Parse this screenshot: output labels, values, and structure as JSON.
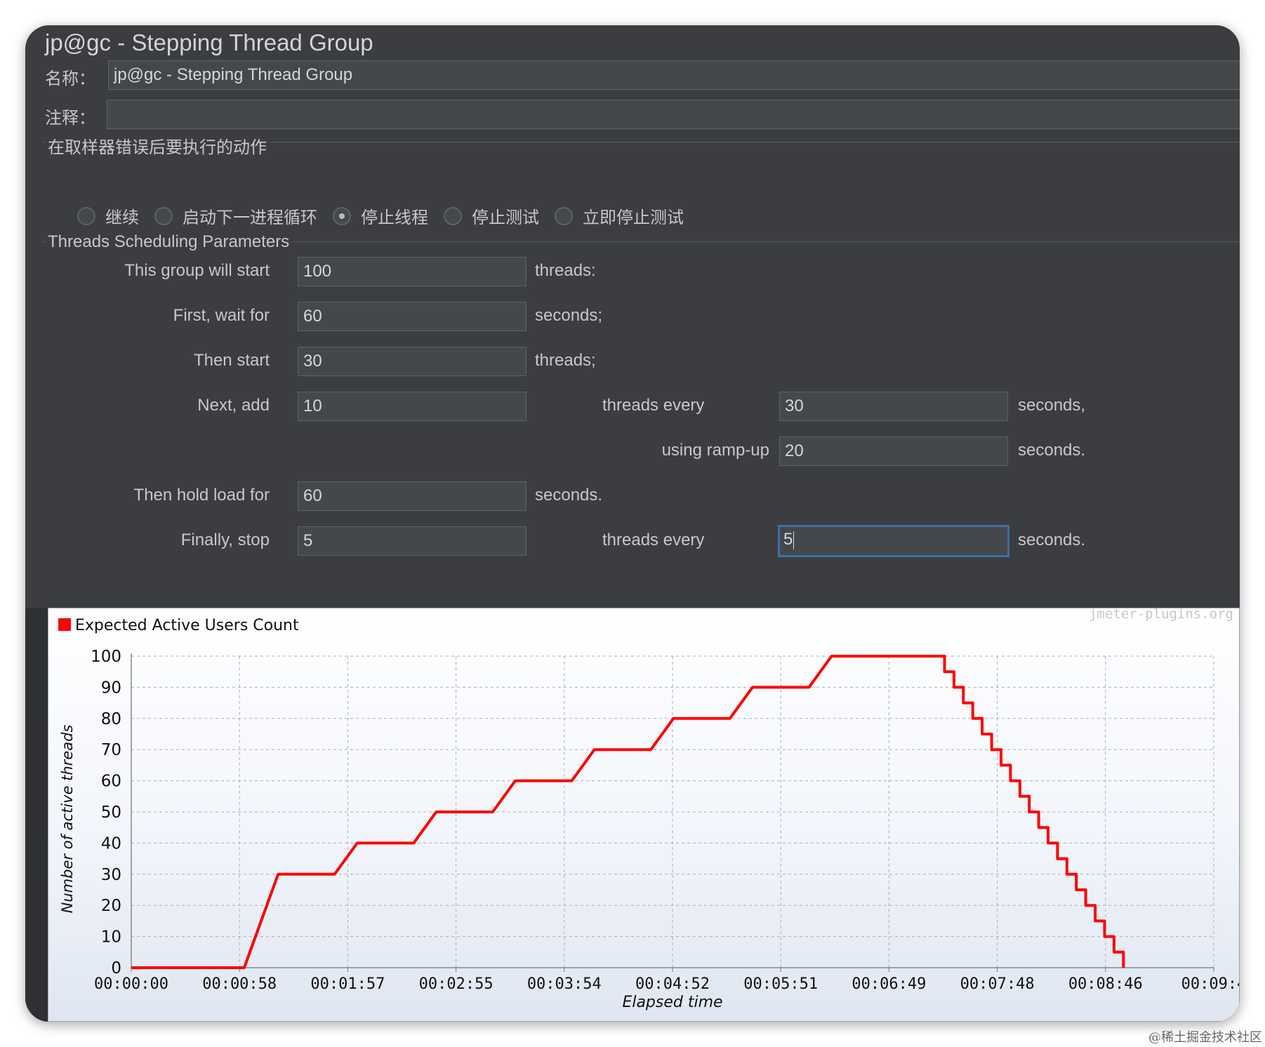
{
  "window": {
    "title": "jp@gc - Stepping Thread Group"
  },
  "name_field": {
    "label": "名称：",
    "value": "jp@gc - Stepping Thread Group"
  },
  "comment_field": {
    "label": "注释：",
    "value": ""
  },
  "error_action": {
    "title": "在取样器错误后要执行的动作",
    "options": [
      {
        "label": "继续",
        "selected": false
      },
      {
        "label": "启动下一进程循环",
        "selected": false
      },
      {
        "label": "停止线程",
        "selected": true
      },
      {
        "label": "停止测试",
        "selected": false
      },
      {
        "label": "立即停止测试",
        "selected": false
      }
    ]
  },
  "scheduling": {
    "title": "Threads Scheduling Parameters",
    "start_label": "This group will start",
    "start_value": "100",
    "start_unit": "threads:",
    "wait_label": "First, wait for",
    "wait_value": "60",
    "wait_unit": "seconds;",
    "then_start_label": "Then start",
    "then_start_value": "30",
    "then_start_unit": "threads;",
    "add_label": "Next, add",
    "add_value": "10",
    "add_mid": "threads every",
    "add_every_value": "30",
    "add_every_unit": "seconds,",
    "rampup_label": "using ramp-up",
    "rampup_value": "20",
    "rampup_unit": "seconds.",
    "hold_label": "Then hold load for",
    "hold_value": "60",
    "hold_unit": "seconds.",
    "stop_label": "Finally, stop",
    "stop_value": "5",
    "stop_mid": "threads every",
    "stop_every_value": "5",
    "stop_every_unit": "seconds."
  },
  "chart_data": {
    "type": "line",
    "legend": "Expected Active Users Count",
    "watermark": "jmeter-plugins.org",
    "xlabel": "Elapsed time",
    "ylabel": "Number of active threads",
    "ylim": [
      0,
      100
    ],
    "xlim": [
      0,
      575
    ],
    "x_ticks": [
      "00:00:00",
      "00:00:58",
      "00:01:57",
      "00:02:55",
      "00:03:54",
      "00:04:52",
      "00:05:51",
      "00:06:49",
      "00:07:48",
      "00:08:46",
      "00:09:4"
    ],
    "y_ticks": [
      "0",
      "10",
      "20",
      "30",
      "40",
      "50",
      "60",
      "70",
      "80",
      "90",
      "100"
    ],
    "grid": true,
    "legend_position": "top-left",
    "series_color": "#ff0000",
    "series": [
      {
        "name": "Expected Active Users Count",
        "points": [
          [
            0,
            0
          ],
          [
            60,
            0
          ],
          [
            63,
            5
          ],
          [
            66,
            10
          ],
          [
            69,
            15
          ],
          [
            72,
            20
          ],
          [
            75,
            25
          ],
          [
            78,
            30
          ],
          [
            108,
            30
          ],
          [
            111,
            32.5
          ],
          [
            114,
            35
          ],
          [
            117,
            37.5
          ],
          [
            120,
            40
          ],
          [
            150,
            40
          ],
          [
            153,
            42.5
          ],
          [
            156,
            45
          ],
          [
            159,
            47.5
          ],
          [
            162,
            50
          ],
          [
            192,
            50
          ],
          [
            195,
            52.5
          ],
          [
            198,
            55
          ],
          [
            201,
            57.5
          ],
          [
            204,
            60
          ],
          [
            234,
            60
          ],
          [
            237,
            62.5
          ],
          [
            240,
            65
          ],
          [
            243,
            67.5
          ],
          [
            246,
            70
          ],
          [
            276,
            70
          ],
          [
            279,
            72.5
          ],
          [
            282,
            75
          ],
          [
            285,
            77.5
          ],
          [
            288,
            80
          ],
          [
            318,
            80
          ],
          [
            321,
            82.5
          ],
          [
            324,
            85
          ],
          [
            327,
            87.5
          ],
          [
            330,
            90
          ],
          [
            360,
            90
          ],
          [
            363,
            92.5
          ],
          [
            366,
            95
          ],
          [
            369,
            97.5
          ],
          [
            372,
            100
          ],
          [
            432,
            100
          ],
          [
            432,
            95
          ],
          [
            437,
            95
          ],
          [
            437,
            90
          ],
          [
            442,
            90
          ],
          [
            442,
            85
          ],
          [
            447,
            85
          ],
          [
            447,
            80
          ],
          [
            452,
            80
          ],
          [
            452,
            75
          ],
          [
            457,
            75
          ],
          [
            457,
            70
          ],
          [
            462,
            70
          ],
          [
            462,
            65
          ],
          [
            467,
            65
          ],
          [
            467,
            60
          ],
          [
            472,
            60
          ],
          [
            472,
            55
          ],
          [
            477,
            55
          ],
          [
            477,
            50
          ],
          [
            482,
            50
          ],
          [
            482,
            45
          ],
          [
            487,
            45
          ],
          [
            487,
            40
          ],
          [
            492,
            40
          ],
          [
            492,
            35
          ],
          [
            497,
            35
          ],
          [
            497,
            30
          ],
          [
            502,
            30
          ],
          [
            502,
            25
          ],
          [
            507,
            25
          ],
          [
            507,
            20
          ],
          [
            512,
            20
          ],
          [
            512,
            15
          ],
          [
            517,
            15
          ],
          [
            517,
            10
          ],
          [
            522,
            10
          ],
          [
            522,
            5
          ],
          [
            527,
            5
          ],
          [
            527,
            0
          ]
        ]
      }
    ]
  },
  "footer": {
    "credit": "@稀土掘金技术社区"
  }
}
